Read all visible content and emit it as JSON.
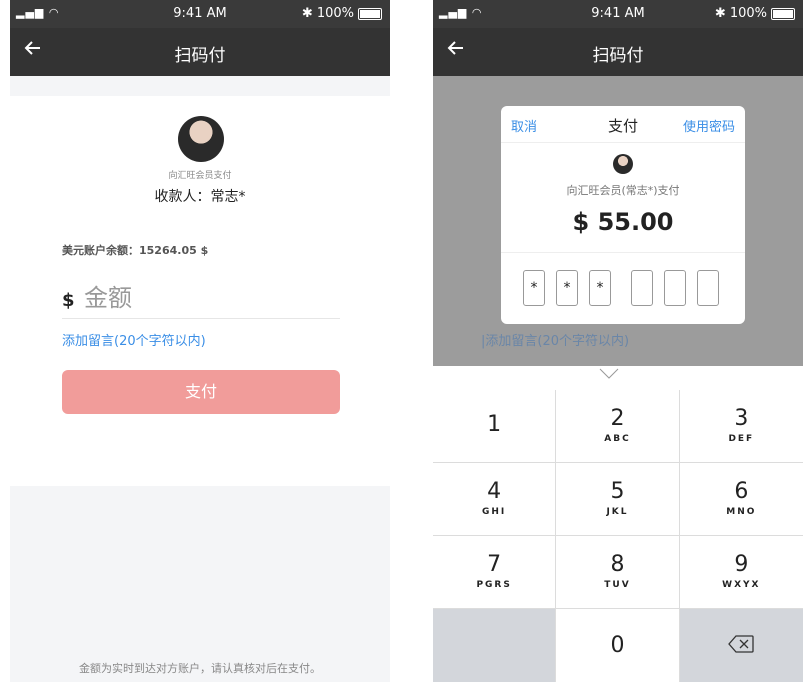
{
  "status_bar": {
    "signal": "▂▄▆ ◠",
    "time": "9:41 AM",
    "battery": "100%",
    "bluetooth": "✱"
  },
  "left": {
    "nav_title": "扫码付",
    "payee_sub": "向汇旺会员支付",
    "payee_name": "收款人：常志*",
    "balance": "美元账户余额：15264.05 $",
    "currency": "$",
    "amount_placeholder": "金额",
    "remark": "添加留言(20个字符以内)",
    "pay_button": "支付",
    "footnote": "金额为实时到达对方账户，请认真核对后在支付。"
  },
  "right": {
    "nav_title": "扫码付",
    "modal": {
      "cancel": "取消",
      "title": "支付",
      "use_password": "使用密码",
      "payee_sub": "向汇旺会员(常志*)支付",
      "amount": "$ 55.00",
      "pin": [
        "*",
        "*",
        "*",
        "",
        "",
        ""
      ]
    },
    "remark": "|添加留言(20个字符以内)",
    "keypad": [
      {
        "num": "1",
        "letters": ""
      },
      {
        "num": "2",
        "letters": "ABC"
      },
      {
        "num": "3",
        "letters": "DEF"
      },
      {
        "num": "4",
        "letters": "GHI"
      },
      {
        "num": "5",
        "letters": "JKL"
      },
      {
        "num": "6",
        "letters": "MNO"
      },
      {
        "num": "7",
        "letters": "PGRS"
      },
      {
        "num": "8",
        "letters": "TUV"
      },
      {
        "num": "9",
        "letters": "WXYX"
      },
      {
        "num": "",
        "letters": ""
      },
      {
        "num": "0",
        "letters": ""
      },
      {
        "num": "",
        "letters": ""
      }
    ]
  },
  "icons": {
    "back": "arrow-left-icon",
    "backspace": "backspace-icon",
    "collapse": "chevron-down-icon"
  },
  "colors": {
    "nav": "#333333",
    "link": "#3a8ee6",
    "pay_button": "#f19c9a"
  }
}
